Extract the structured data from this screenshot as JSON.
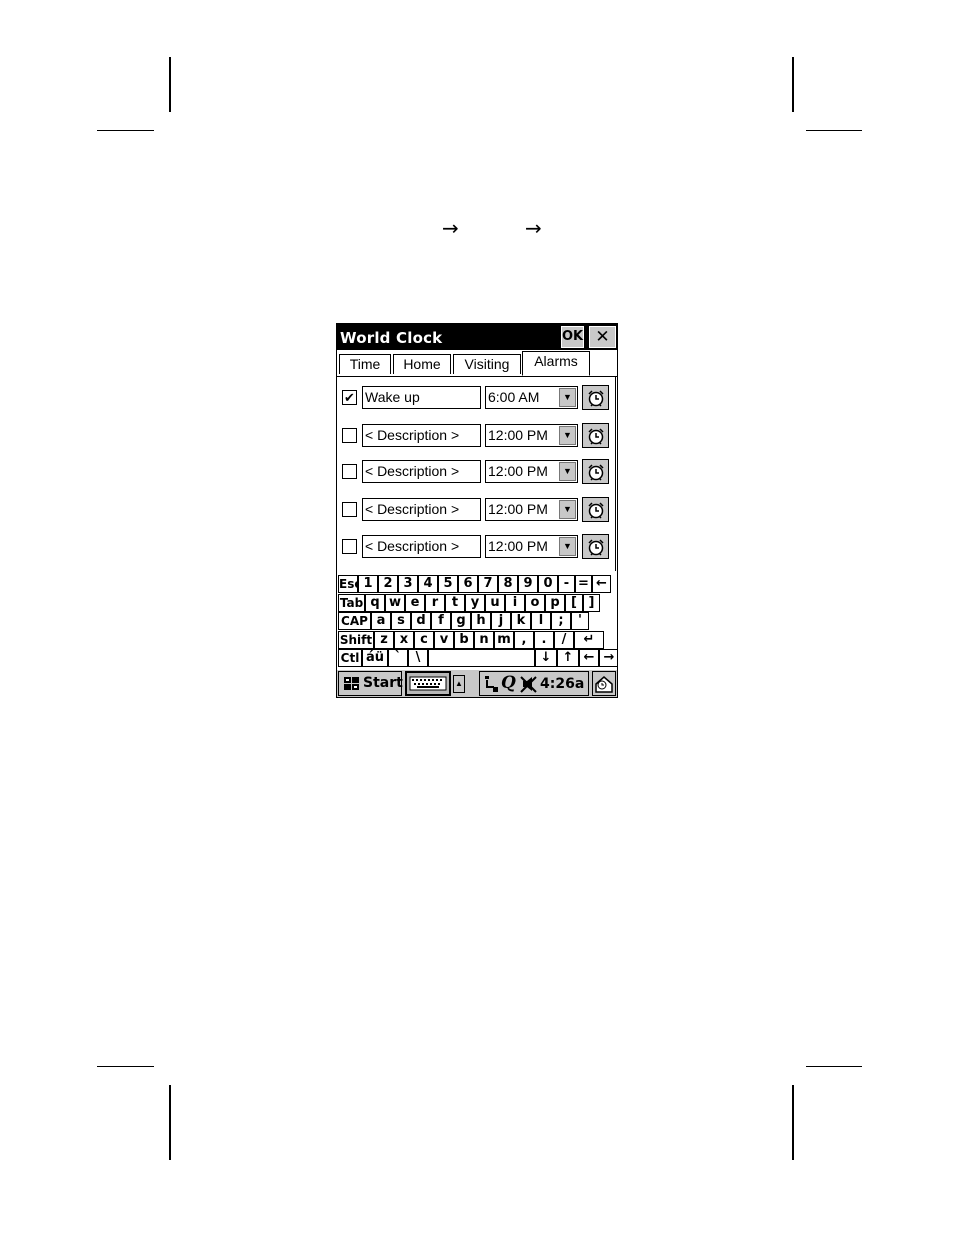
{
  "page": {
    "arrows": [
      "→",
      "→"
    ]
  },
  "window": {
    "title": "World Clock",
    "ok_label": "OK",
    "close_label": "✕"
  },
  "tabs": [
    {
      "label": "Time",
      "active": false
    },
    {
      "label": "Home",
      "active": false
    },
    {
      "label": "Visiting",
      "active": false
    },
    {
      "label": "Alarms",
      "active": true
    }
  ],
  "alarms": [
    {
      "checked": true,
      "description": "Wake up",
      "time": "6:00 AM"
    },
    {
      "checked": false,
      "description": "< Description >",
      "time": "12:00 PM"
    },
    {
      "checked": false,
      "description": "< Description >",
      "time": "12:00 PM"
    },
    {
      "checked": false,
      "description": "< Description >",
      "time": "12:00 PM"
    },
    {
      "checked": false,
      "description": "< Description >",
      "time": "12:00 PM"
    }
  ],
  "keyboard": {
    "rows": [
      [
        "Esc",
        "1",
        "2",
        "3",
        "4",
        "5",
        "6",
        "7",
        "8",
        "9",
        "0",
        "-",
        "=",
        "←"
      ],
      [
        "Tab",
        "q",
        "w",
        "e",
        "r",
        "t",
        "y",
        "u",
        "i",
        "o",
        "p",
        "[",
        "]"
      ],
      [
        "CAP",
        "a",
        "s",
        "d",
        "f",
        "g",
        "h",
        "j",
        "k",
        "l",
        ";",
        "'"
      ],
      [
        "Shift",
        "z",
        "x",
        "c",
        "v",
        "b",
        "n",
        "m",
        ",",
        ".",
        "/",
        "↵"
      ],
      [
        "Ctl",
        "áü",
        "`",
        "\\",
        " ",
        "↓",
        "↑",
        "←",
        "→"
      ]
    ]
  },
  "taskbar": {
    "start_label": "Start",
    "clock": "4:26a",
    "icons": [
      "start-flag-icon",
      "keyboard-icon",
      "chevron-up-icon",
      "connection-icon",
      "q-icon",
      "speaker-icon",
      "desktop-icon"
    ]
  },
  "checkmark": "✔",
  "dropdown_glyph": "▼",
  "up_glyph": "▲"
}
